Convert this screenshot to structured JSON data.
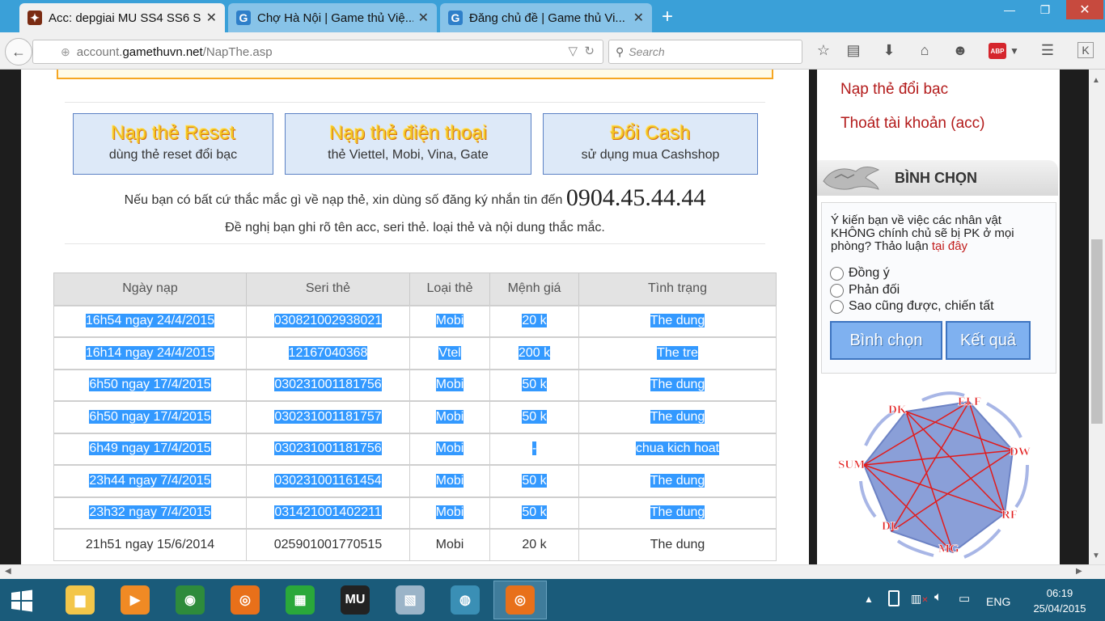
{
  "browser": {
    "tabs": [
      {
        "title": "Acc: depgiai MU SS4 SS6 S...",
        "favicon": "mu-game-icon",
        "active": true
      },
      {
        "title": "Chợ Hà Nội | Game thủ Việ...",
        "favicon": "G",
        "active": false
      },
      {
        "title": "Đăng chủ đề | Game thủ Vi...",
        "favicon": "G",
        "active": false
      }
    ],
    "url_prefix": "account.",
    "url_domain": "gamethuvn.net",
    "url_path": "/NapThe.asp",
    "search_placeholder": "Search",
    "abp_label": "ABP"
  },
  "main": {
    "buttons": [
      {
        "title": "Nạp thẻ Reset",
        "subtitle": "dùng thẻ reset đổi bạc"
      },
      {
        "title": "Nạp thẻ điện thoại",
        "subtitle": "thẻ Viettel, Mobi, Vina, Gate"
      },
      {
        "title": "Đổi Cash",
        "subtitle": "sử dụng mua Cashshop"
      }
    ],
    "notice_line1": "Nếu bạn có bất cứ thắc mắc gì về nạp thẻ, xin dùng số đăng ký nhắn tin đến",
    "phone": "0904.45.44.44",
    "notice_line2": "Đề nghị bạn ghi rõ tên acc, seri thẻ. loại thẻ và nội dung thắc mắc."
  },
  "table": {
    "headers": [
      "Ngày nạp",
      "Seri thẻ",
      "Loại thẻ",
      "Mệnh giá",
      "Tình trạng"
    ],
    "rows": [
      {
        "cells": [
          "16h54 ngay 24/4/2015",
          "030821002938021",
          "Mobi",
          "20 k",
          "The dung"
        ],
        "selected": true
      },
      {
        "cells": [
          "16h14 ngay 24/4/2015",
          "12167040368",
          "Vtel",
          "200 k",
          "The tre"
        ],
        "selected": true
      },
      {
        "cells": [
          "6h50 ngay 17/4/2015",
          "030231001181756",
          "Mobi",
          "50 k",
          "The dung"
        ],
        "selected": true
      },
      {
        "cells": [
          "6h50 ngay 17/4/2015",
          "030231001181757",
          "Mobi",
          "50 k",
          "The dung"
        ],
        "selected": true
      },
      {
        "cells": [
          "6h49 ngay 17/4/2015",
          "030231001181756",
          "Mobi",
          "-",
          "chua kich hoat"
        ],
        "selected": true
      },
      {
        "cells": [
          "23h44 ngay 7/4/2015",
          "030231001161454",
          "Mobi",
          "50 k",
          "The dung"
        ],
        "selected": true
      },
      {
        "cells": [
          "23h32 ngay 7/4/2015",
          "031421001402211",
          "Mobi",
          "50 k",
          "The dung"
        ],
        "selected": true
      },
      {
        "cells": [
          "21h51 ngay 15/6/2014",
          "025901001770515",
          "Mobi",
          "20 k",
          "The dung"
        ],
        "selected": false
      }
    ]
  },
  "sidebar": {
    "links": [
      "Nạp thẻ đổi bạc",
      "Thoát tài khoản (acc)"
    ],
    "vote_title": "BÌNH CHỌN",
    "vote_question": "Ý kiến bạn về việc các nhân vật KHÔNG chính chủ sẽ bị PK ở mọi phòng? Thảo luận",
    "vote_link": "tại đây",
    "options": [
      "Đồng ý",
      "Phản đối",
      "Sao cũng được, chiến tất"
    ],
    "vote_button": "Bình chọn",
    "result_button": "Kết quả",
    "diagram_labels": [
      "DK",
      "ELF",
      "DW",
      "RF",
      "MG",
      "DL",
      "SUM"
    ]
  },
  "taskbar": {
    "lang": "ENG",
    "time": "06:19",
    "date": "25/04/2015",
    "apps": [
      "file-explorer-icon",
      "media-player-icon",
      "chrome-icon",
      "firefox-icon",
      "store-icon",
      "mu-game-icon",
      "performance-monitor-icon",
      "network-icon",
      "firefox-active-icon"
    ]
  }
}
